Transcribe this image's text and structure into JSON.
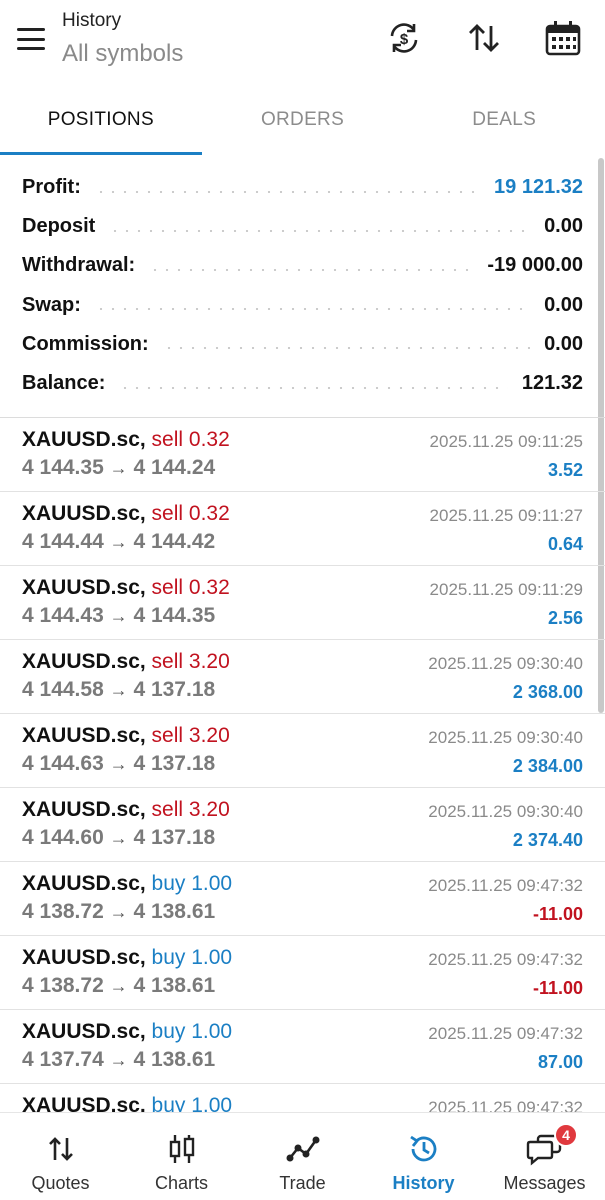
{
  "header": {
    "title": "History",
    "subtitle": "All symbols",
    "icons": [
      "menu-icon",
      "currency-exchange-icon",
      "sort-icon",
      "calendar-icon"
    ]
  },
  "tabs": [
    {
      "label": "POSITIONS",
      "active": true
    },
    {
      "label": "ORDERS",
      "active": false
    },
    {
      "label": "DEALS",
      "active": false
    }
  ],
  "summary": [
    {
      "label": "Profit:",
      "value": "19 121.32",
      "highlight": true
    },
    {
      "label": "Deposit",
      "value": "0.00",
      "highlight": false
    },
    {
      "label": "Withdrawal:",
      "value": "-19 000.00",
      "highlight": false
    },
    {
      "label": "Swap:",
      "value": "0.00",
      "highlight": false
    },
    {
      "label": "Commission:",
      "value": "0.00",
      "highlight": false
    },
    {
      "label": "Balance:",
      "value": "121.32",
      "highlight": false
    }
  ],
  "deals": [
    {
      "symbol": "XAUUSD.sc,",
      "side": "sell 0.32",
      "type": "sell",
      "open": "4 144.35",
      "close": "4 144.24",
      "time": "2025.11.25 09:11:25",
      "profit": "3.52",
      "profit_sign": "pos"
    },
    {
      "symbol": "XAUUSD.sc,",
      "side": "sell 0.32",
      "type": "sell",
      "open": "4 144.44",
      "close": "4 144.42",
      "time": "2025.11.25 09:11:27",
      "profit": "0.64",
      "profit_sign": "pos"
    },
    {
      "symbol": "XAUUSD.sc,",
      "side": "sell 0.32",
      "type": "sell",
      "open": "4 144.43",
      "close": "4 144.35",
      "time": "2025.11.25 09:11:29",
      "profit": "2.56",
      "profit_sign": "pos"
    },
    {
      "symbol": "XAUUSD.sc,",
      "side": "sell 3.20",
      "type": "sell",
      "open": "4 144.58",
      "close": "4 137.18",
      "time": "2025.11.25 09:30:40",
      "profit": "2 368.00",
      "profit_sign": "pos"
    },
    {
      "symbol": "XAUUSD.sc,",
      "side": "sell 3.20",
      "type": "sell",
      "open": "4 144.63",
      "close": "4 137.18",
      "time": "2025.11.25 09:30:40",
      "profit": "2 384.00",
      "profit_sign": "pos"
    },
    {
      "symbol": "XAUUSD.sc,",
      "side": "sell 3.20",
      "type": "sell",
      "open": "4 144.60",
      "close": "4 137.18",
      "time": "2025.11.25 09:30:40",
      "profit": "2 374.40",
      "profit_sign": "pos"
    },
    {
      "symbol": "XAUUSD.sc,",
      "side": "buy 1.00",
      "type": "buy",
      "open": "4 138.72",
      "close": "4 138.61",
      "time": "2025.11.25 09:47:32",
      "profit": "-11.00",
      "profit_sign": "neg"
    },
    {
      "symbol": "XAUUSD.sc,",
      "side": "buy 1.00",
      "type": "buy",
      "open": "4 138.72",
      "close": "4 138.61",
      "time": "2025.11.25 09:47:32",
      "profit": "-11.00",
      "profit_sign": "neg"
    },
    {
      "symbol": "XAUUSD.sc,",
      "side": "buy 1.00",
      "type": "buy",
      "open": "4 137.74",
      "close": "4 138.61",
      "time": "2025.11.25 09:47:32",
      "profit": "87.00",
      "profit_sign": "pos"
    },
    {
      "symbol": "XAUUSD.sc,",
      "side": "buy 1.00",
      "type": "buy",
      "open": "",
      "close": "",
      "time": "2025.11.25 09:47:32",
      "profit": "",
      "profit_sign": "pos"
    }
  ],
  "arrow": "→",
  "bottom_nav": [
    {
      "label": "Quotes",
      "icon": "quotes-icon",
      "active": false
    },
    {
      "label": "Charts",
      "icon": "charts-icon",
      "active": false
    },
    {
      "label": "Trade",
      "icon": "trade-icon",
      "active": false
    },
    {
      "label": "History",
      "icon": "history-icon",
      "active": true
    },
    {
      "label": "Messages",
      "icon": "messages-icon",
      "active": false,
      "badge": "4"
    }
  ],
  "colors": {
    "accent": "#1b7fc4",
    "sell": "#c1121f",
    "negative": "#c1121f",
    "badge": "#e0393e"
  }
}
